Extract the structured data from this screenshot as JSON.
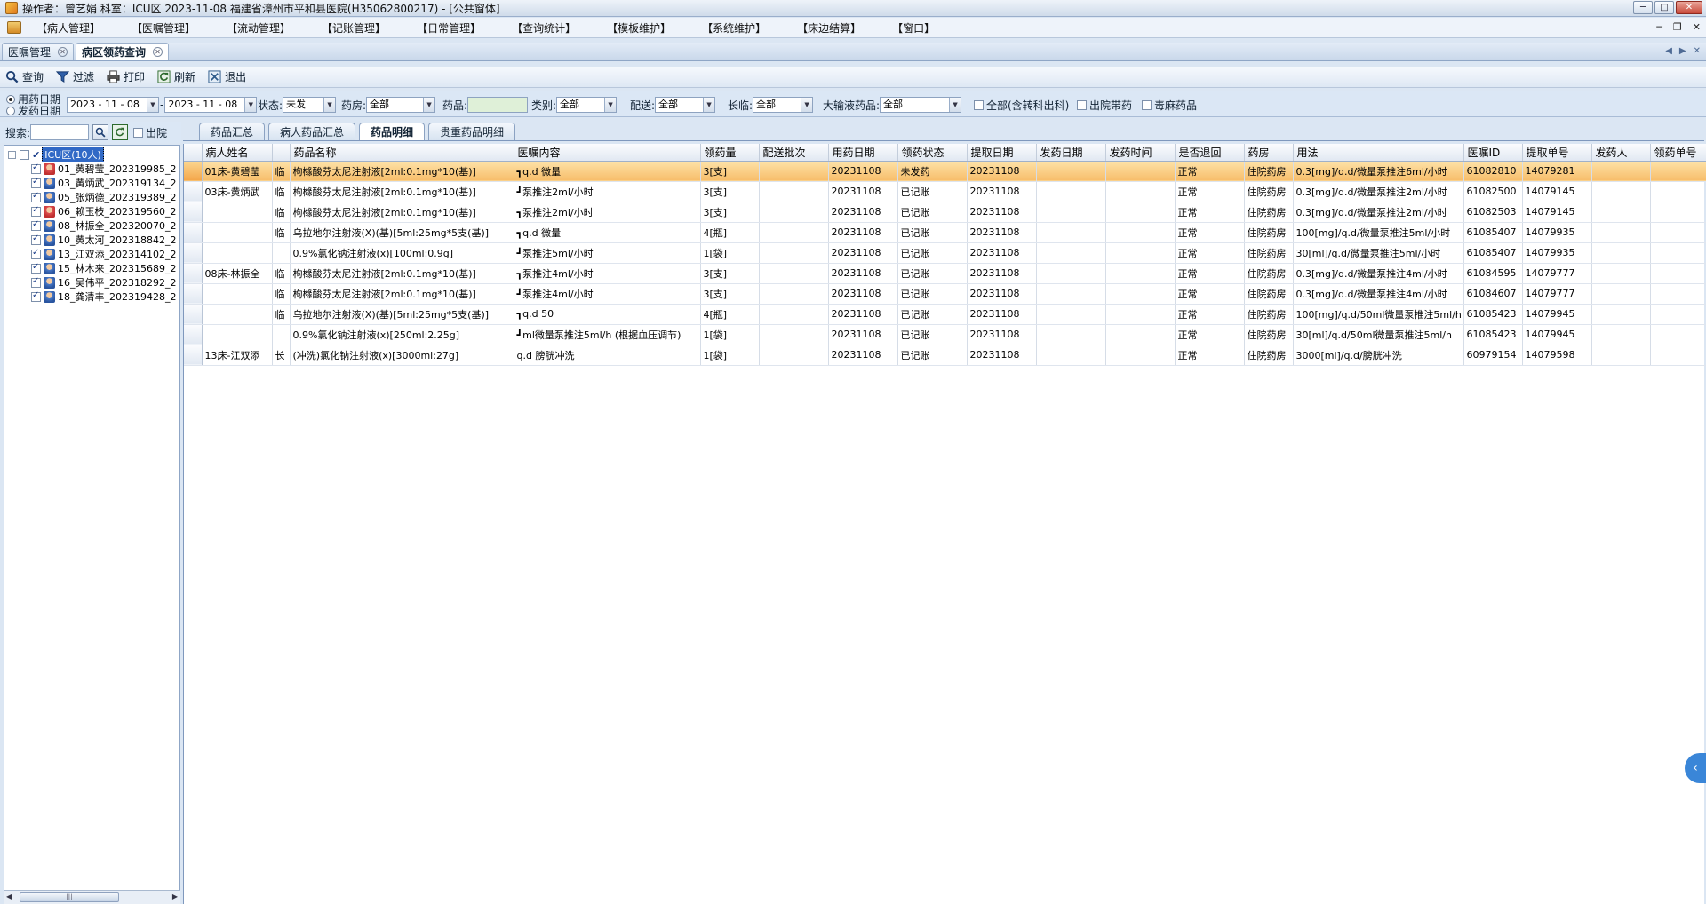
{
  "window": {
    "title": "操作者：曾艺娟  科室：ICU区  2023-11-08  福建省漳州市平和县医院(H35062800217) - [公共窗体]"
  },
  "menu": [
    "【病人管理】",
    "【医嘱管理】",
    "【流动管理】",
    "【记账管理】",
    "【日常管理】",
    "【查询统计】",
    "【模板维护】",
    "【系统维护】",
    "【床边结算】",
    "【窗口】"
  ],
  "page_tabs": [
    {
      "label": "医嘱管理"
    },
    {
      "label": "病区领药查询"
    }
  ],
  "toolbar": {
    "query": "查询",
    "filter": "过滤",
    "print": "打印",
    "refresh": "刷新",
    "exit": "退出"
  },
  "filters": {
    "radio_use_date": "用药日期",
    "radio_dispense_date": "发药日期",
    "date_from": "2023 - 11 - 08",
    "date_sep": "-",
    "date_to": "2023 - 11 - 08",
    "status_label": "状态:",
    "status_value": "未发",
    "pharmacy_label": "药房:",
    "pharmacy_value": "全部",
    "drug_label": "药品:",
    "drug_value": "",
    "category_label": "类别:",
    "category_value": "全部",
    "delivery_label": "配送:",
    "delivery_value": "全部",
    "longterm_label": "长临:",
    "longterm_value": "全部",
    "infusion_label": "大输液药品:",
    "infusion_value": "全部",
    "cb_all_transfer": "全部(含转科出科)",
    "cb_discharge": "出院带药",
    "cb_toxic": "毒麻药品"
  },
  "left_panel": {
    "search_label": "搜索:",
    "search_value": "",
    "discharged_label": "出院",
    "root": "ICU区(10人)",
    "patients": [
      {
        "label": "01_黄碧莹_202319985_2",
        "sex": "f"
      },
      {
        "label": "03_黄炳武_202319134_2",
        "sex": "m"
      },
      {
        "label": "05_张炳德_202319389_2",
        "sex": "m"
      },
      {
        "label": "06_赖玉枝_202319560_2",
        "sex": "f"
      },
      {
        "label": "08_林振全_202320070_2",
        "sex": "m"
      },
      {
        "label": "10_黄太河_202318842_2",
        "sex": "m"
      },
      {
        "label": "13_江双添_202314102_2",
        "sex": "m"
      },
      {
        "label": "15_林木来_202315689_2",
        "sex": "m"
      },
      {
        "label": "16_吴伟平_202318292_2",
        "sex": "m"
      },
      {
        "label": "18_龚清丰_202319428_2",
        "sex": "m"
      }
    ]
  },
  "grid_tabs": [
    "药品汇总",
    "病人药品汇总",
    "药品明细",
    "贵重药品明细"
  ],
  "table": {
    "columns": [
      "病人姓名",
      "",
      "药品名称",
      "医嘱内容",
      "领药量",
      "配送批次",
      "用药日期",
      "领药状态",
      "提取日期",
      "发药日期",
      "发药时间",
      "是否退回",
      "药房",
      "用法",
      "医嘱ID",
      "提取单号",
      "发药人",
      "领药单号"
    ],
    "rows": [
      [
        "01床-黄碧莹",
        "临",
        "枸橼酸芬太尼注射液[2ml:0.1mg*10(基)]",
        "┓q.d 微量",
        "3[支]",
        "",
        "20231108",
        "未发药",
        "20231108",
        "",
        "",
        "正常",
        "住院药房",
        "0.3[mg]/q.d/微量泵推注6ml/小时",
        "61082810",
        "14079281",
        "",
        ""
      ],
      [
        "03床-黄炳武",
        "临",
        "枸橼酸芬太尼注射液[2ml:0.1mg*10(基)]",
        "┛泵推注2ml/小时",
        "3[支]",
        "",
        "20231108",
        "已记账",
        "20231108",
        "",
        "",
        "正常",
        "住院药房",
        "0.3[mg]/q.d/微量泵推注2ml/小时",
        "61082500",
        "14079145",
        "",
        ""
      ],
      [
        "",
        "临",
        "枸橼酸芬太尼注射液[2ml:0.1mg*10(基)]",
        "┓泵推注2ml/小时",
        "3[支]",
        "",
        "20231108",
        "已记账",
        "20231108",
        "",
        "",
        "正常",
        "住院药房",
        "0.3[mg]/q.d/微量泵推注2ml/小时",
        "61082503",
        "14079145",
        "",
        ""
      ],
      [
        "",
        "临",
        "乌拉地尔注射液(X)(基)[5ml:25mg*5支(基)]",
        "┓q.d 微量",
        "4[瓶]",
        "",
        "20231108",
        "已记账",
        "20231108",
        "",
        "",
        "正常",
        "住院药房",
        "100[mg]/q.d/微量泵推注5ml/小时",
        "61085407",
        "14079935",
        "",
        ""
      ],
      [
        "",
        "",
        "0.9%氯化钠注射液(x)[100ml:0.9g]",
        "┛泵推注5ml/小时",
        "1[袋]",
        "",
        "20231108",
        "已记账",
        "20231108",
        "",
        "",
        "正常",
        "住院药房",
        "30[ml]/q.d/微量泵推注5ml/小时",
        "61085407",
        "14079935",
        "",
        ""
      ],
      [
        "08床-林振全",
        "临",
        "枸橼酸芬太尼注射液[2ml:0.1mg*10(基)]",
        "┓泵推注4ml/小时",
        "3[支]",
        "",
        "20231108",
        "已记账",
        "20231108",
        "",
        "",
        "正常",
        "住院药房",
        "0.3[mg]/q.d/微量泵推注4ml/小时",
        "61084595",
        "14079777",
        "",
        ""
      ],
      [
        "",
        "临",
        "枸橼酸芬太尼注射液[2ml:0.1mg*10(基)]",
        "┛泵推注4ml/小时",
        "3[支]",
        "",
        "20231108",
        "已记账",
        "20231108",
        "",
        "",
        "正常",
        "住院药房",
        "0.3[mg]/q.d/微量泵推注4ml/小时",
        "61084607",
        "14079777",
        "",
        ""
      ],
      [
        "",
        "临",
        "乌拉地尔注射液(X)(基)[5ml:25mg*5支(基)]",
        "┓q.d 50",
        "4[瓶]",
        "",
        "20231108",
        "已记账",
        "20231108",
        "",
        "",
        "正常",
        "住院药房",
        "100[mg]/q.d/50ml微量泵推注5ml/h",
        "61085423",
        "14079945",
        "",
        ""
      ],
      [
        "",
        "",
        "0.9%氯化钠注射液(x)[250ml:2.25g]",
        "┛ml微量泵推注5ml/h (根据血压调节)",
        "1[袋]",
        "",
        "20231108",
        "已记账",
        "20231108",
        "",
        "",
        "正常",
        "住院药房",
        "30[ml]/q.d/50ml微量泵推注5ml/h",
        "61085423",
        "14079945",
        "",
        ""
      ],
      [
        "13床-江双添",
        "长",
        "(冲洗)氯化钠注射液(x)[3000ml:27g]",
        "q.d 膀胱冲洗",
        "1[袋]",
        "",
        "20231108",
        "已记账",
        "20231108",
        "",
        "",
        "正常",
        "住院药房",
        "3000[ml]/q.d/膀胱冲洗",
        "60979154",
        "14079598",
        "",
        ""
      ]
    ]
  }
}
